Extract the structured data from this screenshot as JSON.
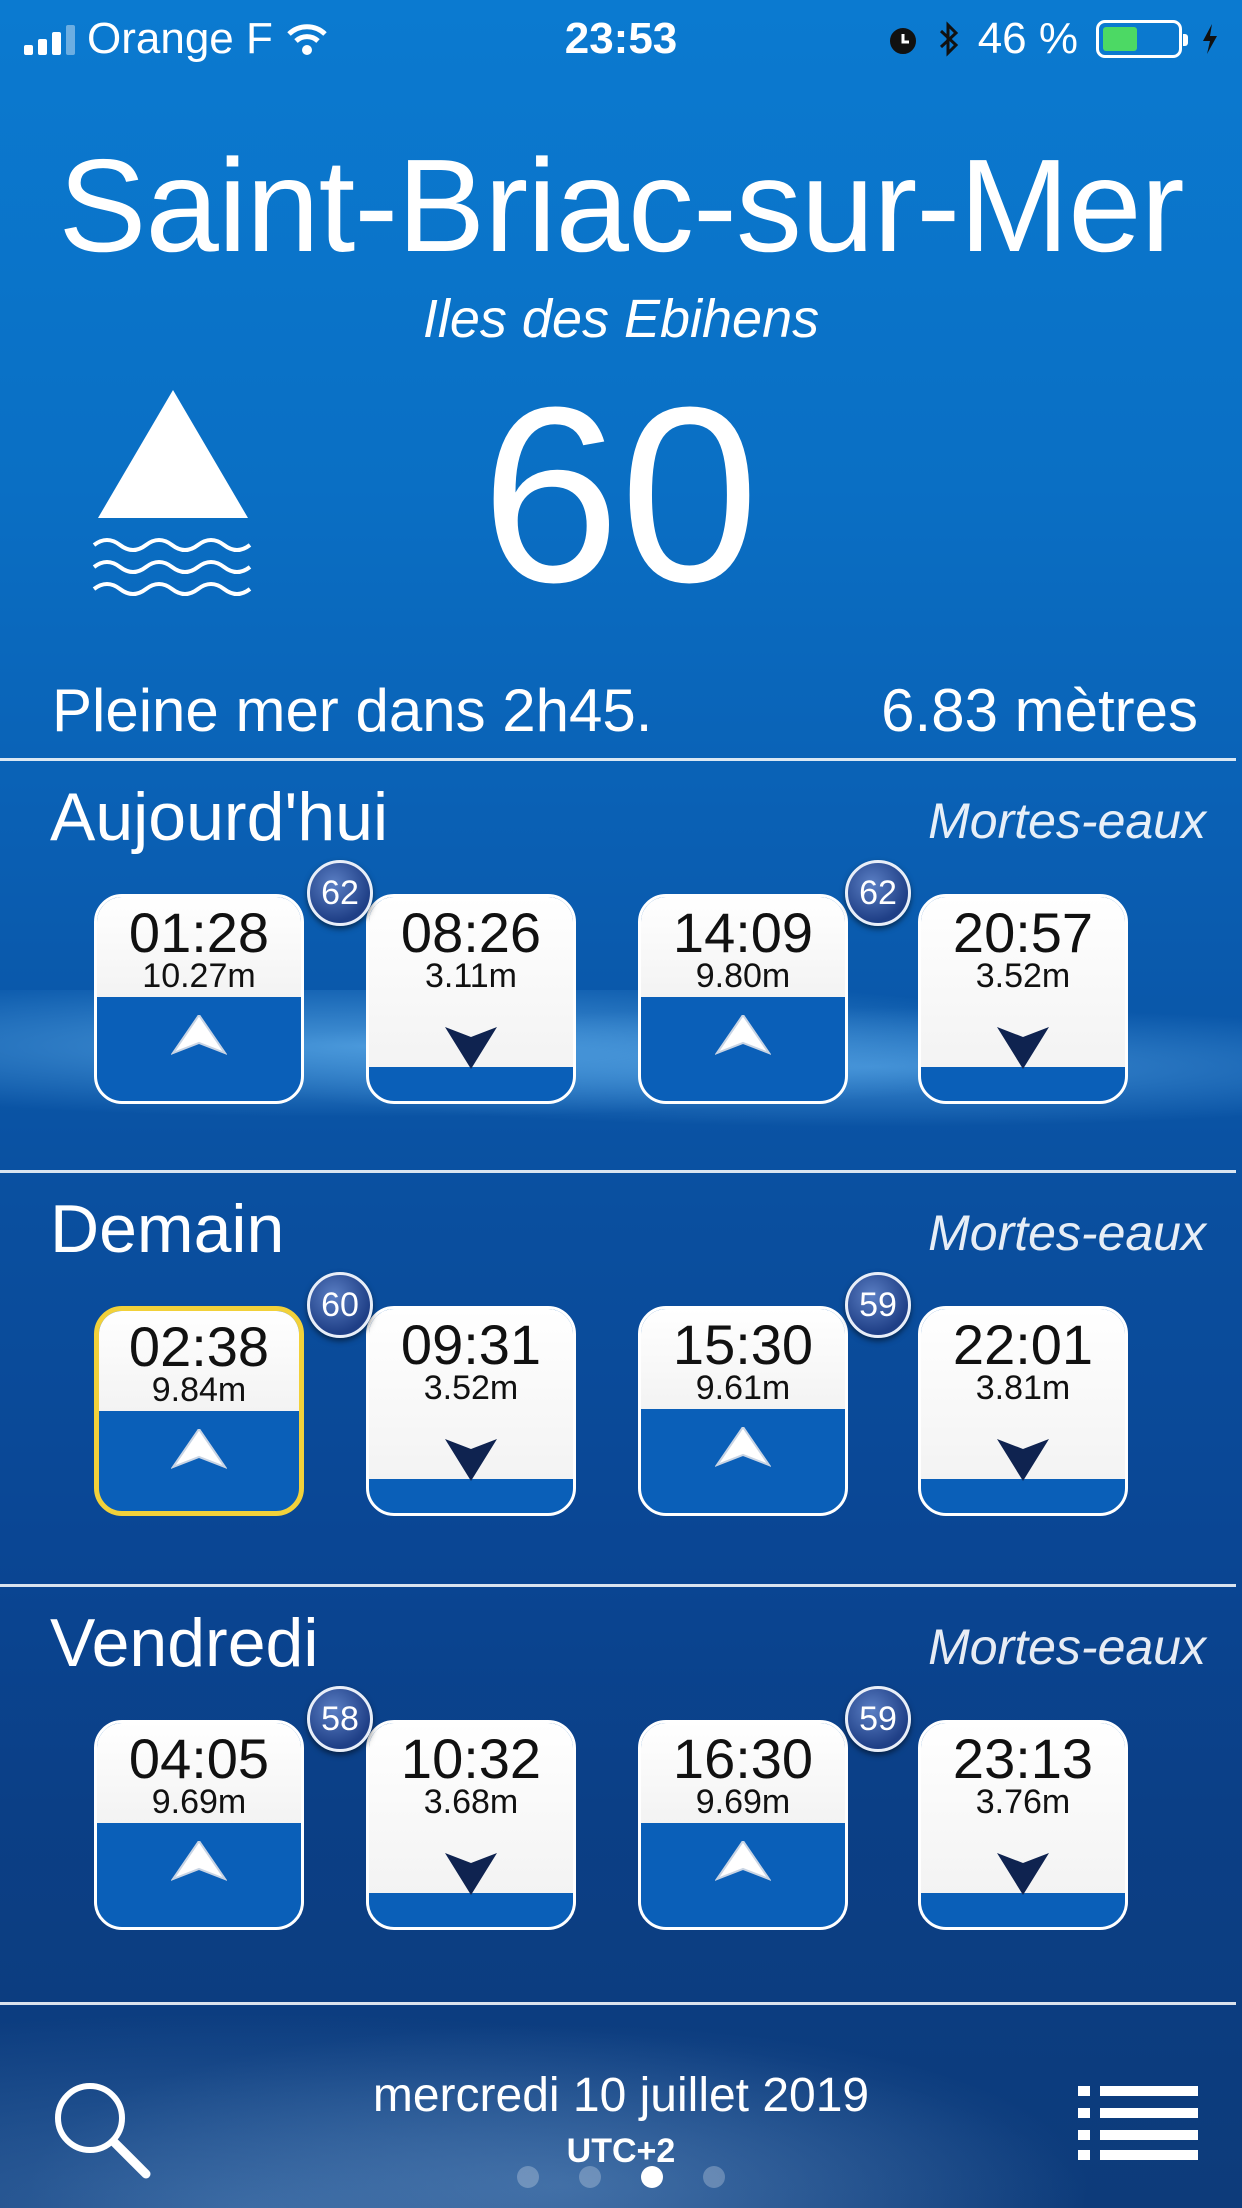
{
  "status_bar": {
    "carrier": "Orange F",
    "time": "23:53",
    "battery": "46 %",
    "battery_level": 0.46
  },
  "header": {
    "city": "Saint-Briac-sur-Mer",
    "location": "Iles des Ebihens",
    "coefficient": "60",
    "next_tide": "Pleine mer dans 2h45.",
    "next_height": "6.83  mètres"
  },
  "days": [
    {
      "title": "Aujourd'hui",
      "period": "Mortes-eaux",
      "badges": [
        "62",
        "62"
      ],
      "tides": [
        {
          "time": "01:28",
          "height": "10.27m",
          "type": "high"
        },
        {
          "time": "08:26",
          "height": "3.11m",
          "type": "low"
        },
        {
          "time": "14:09",
          "height": "9.80m",
          "type": "high"
        },
        {
          "time": "20:57",
          "height": "3.52m",
          "type": "low"
        }
      ]
    },
    {
      "title": "Demain",
      "period": "Mortes-eaux",
      "badges": [
        "60",
        "59"
      ],
      "tides": [
        {
          "time": "02:38",
          "height": "9.84m",
          "type": "high"
        },
        {
          "time": "09:31",
          "height": "3.52m",
          "type": "low"
        },
        {
          "time": "15:30",
          "height": "9.61m",
          "type": "high"
        },
        {
          "time": "22:01",
          "height": "3.81m",
          "type": "low"
        }
      ]
    },
    {
      "title": "Vendredi",
      "period": "Mortes-eaux",
      "badges": [
        "58",
        "59"
      ],
      "tides": [
        {
          "time": "04:05",
          "height": "9.69m",
          "type": "high"
        },
        {
          "time": "10:32",
          "height": "3.68m",
          "type": "low"
        },
        {
          "time": "16:30",
          "height": "9.69m",
          "type": "high"
        },
        {
          "time": "23:13",
          "height": "3.76m",
          "type": "low"
        }
      ]
    }
  ],
  "footer": {
    "date": "mercredi 10 juillet 2019",
    "timezone": "UTC+2",
    "page_count": 4,
    "active_page": 3
  },
  "icons": {
    "search": "search-icon",
    "menu": "list-menu-icon",
    "high_tide": "up-arrow-icon",
    "low_tide": "down-arrow-icon"
  },
  "colors": {
    "selected_border": "#f2d13a",
    "battery": "#4cd964",
    "badge": "#1f3f86",
    "low_arrow": "#0f2350"
  }
}
